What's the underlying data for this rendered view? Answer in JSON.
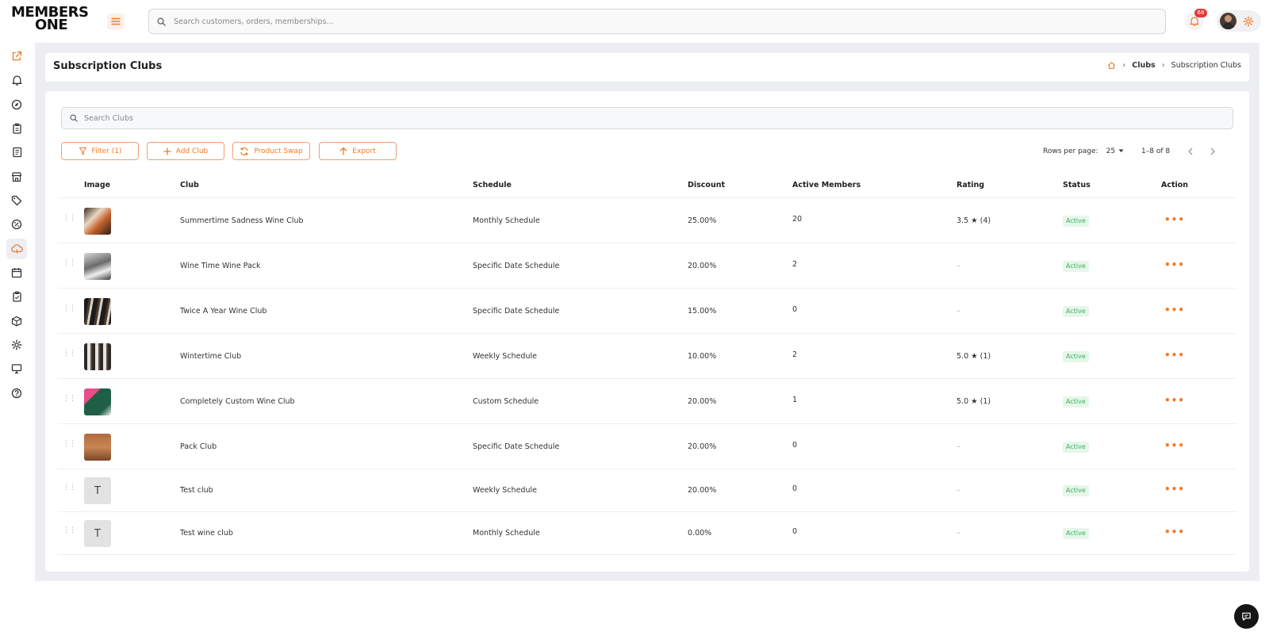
{
  "brand": {
    "logo_line1": "MEMBERS",
    "logo_line2": "ONE",
    "accent": "#f07a28"
  },
  "topbar": {
    "search_placeholder": "Search customers, orders, memberships...",
    "notification_count": "68"
  },
  "header": {
    "title": "Subscription Clubs",
    "breadcrumb": [
      "Clubs",
      "Subscription Clubs"
    ]
  },
  "search": {
    "placeholder": "Search Clubs"
  },
  "toolbar": {
    "filter": "Filter (1)",
    "add": "Add Club",
    "swap": "Product Swap",
    "export": "Export"
  },
  "pager": {
    "rows_label": "Rows per page:",
    "rows_value": "25",
    "range": "1–8 of 8"
  },
  "table": {
    "columns": [
      "Image",
      "Club",
      "Schedule",
      "Discount",
      "Active Members",
      "Rating",
      "Status",
      "Action"
    ],
    "rows": [
      {
        "thumb": "photo-1",
        "club": "Summertime Sadness Wine Club",
        "schedule": "Monthly Schedule",
        "discount": "25.00%",
        "members": "20",
        "rating": "3.5 ★ (4)",
        "status": "Active"
      },
      {
        "thumb": "photo-2",
        "club": "Wine Time Wine Pack",
        "schedule": "Specific Date Schedule",
        "discount": "20.00%",
        "members": "2",
        "rating": "–",
        "status": "Active"
      },
      {
        "thumb": "photo-3",
        "club": "Twice A Year Wine Club",
        "schedule": "Specific Date Schedule",
        "discount": "15.00%",
        "members": "0",
        "rating": "–",
        "status": "Active"
      },
      {
        "thumb": "photo-4",
        "club": "Wintertime Club",
        "schedule": "Weekly Schedule",
        "discount": "10.00%",
        "members": "2",
        "rating": "5.0 ★ (1)",
        "status": "Active"
      },
      {
        "thumb": "photo-5",
        "club": "Completely Custom Wine Club",
        "schedule": "Custom Schedule",
        "discount": "20.00%",
        "members": "1",
        "rating": "5.0 ★ (1)",
        "status": "Active"
      },
      {
        "thumb": "photo-6",
        "club": "Pack Club",
        "schedule": "Specific Date Schedule",
        "discount": "20.00%",
        "members": "0",
        "rating": "–",
        "status": "Active"
      },
      {
        "thumb": "T",
        "club": "Test club",
        "schedule": "Weekly Schedule",
        "discount": "20.00%",
        "members": "0",
        "rating": "–",
        "status": "Active"
      },
      {
        "thumb": "T",
        "club": "Test wine club",
        "schedule": "Monthly Schedule",
        "discount": "0.00%",
        "members": "0",
        "rating": "–",
        "status": "Active"
      }
    ]
  },
  "sidebar": {
    "items": [
      "external-link-icon",
      "bell-icon",
      "compass-icon",
      "clipboard-icon",
      "book-icon",
      "store-icon",
      "tag-icon",
      "percent-icon",
      "clubs-icon",
      "calendar-icon",
      "checklist-icon",
      "package-icon",
      "settings-icon",
      "monitor-icon",
      "help-icon"
    ],
    "active_index": 8
  }
}
